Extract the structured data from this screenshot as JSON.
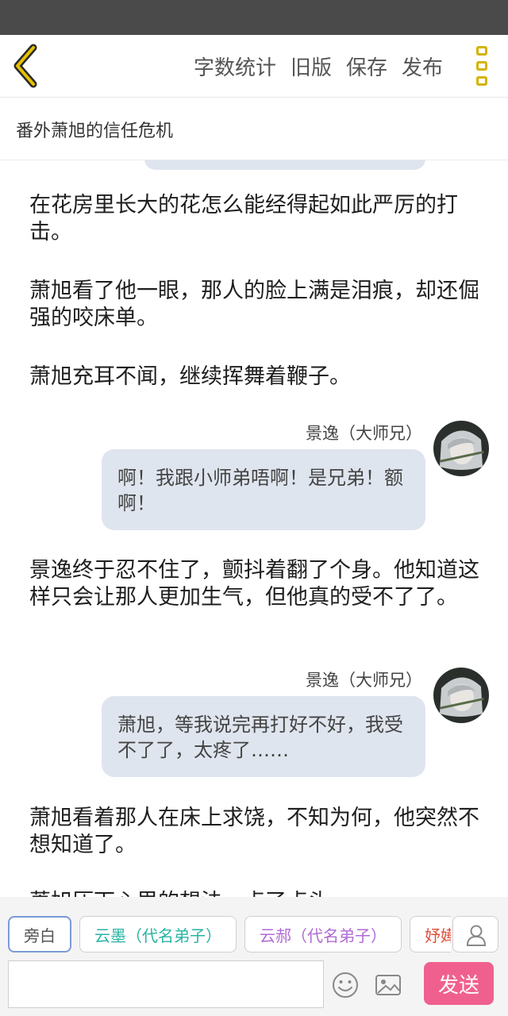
{
  "header": {
    "actions": [
      "字数统计",
      "旧版",
      "保存",
      "发布"
    ],
    "title": "番外萧旭的信任危机"
  },
  "story": {
    "paragraphs": [
      "在花房里长大的花怎么能经得起如此严厉的打击。",
      "萧旭看了他一眼，那人的脸上满是泪痕，却还倔强的咬床单。",
      "萧旭充耳不闻，继续挥舞着鞭子。",
      "景逸终于忍不住了，颤抖着翻了个身。他知道这样只会让那人更加生气，但他真的受不了了。",
      "萧旭看着那人在床上求饶，不知为何，他突然不想知道了。",
      "萧旭压下心里的想法，点了点头。"
    ],
    "dialogues": [
      {
        "speaker": "景逸（大师兄）",
        "text": "啊！我跟小师弟唔啊！是兄弟！额啊！"
      },
      {
        "speaker": "景逸（大师兄）",
        "text": "萧旭，等我说完再打好不好，我受不了了，太疼了……"
      }
    ]
  },
  "roles": [
    "旁白",
    "云墨（代名弟子）",
    "云郝（代名弟子）",
    "妤嬅"
  ],
  "composer": {
    "input_value": "",
    "send_label": "发送"
  },
  "icons": {
    "back": "chevron-left-icon",
    "menu": "more-vertical-icon",
    "user": "user-icon",
    "emoji": "smiley-icon",
    "image": "image-icon"
  },
  "colors": {
    "accent_yellow": "#d4b300",
    "bubble_bg": "#dfe5ee",
    "send_pink": "#f0608f",
    "role_narration": "#555555",
    "role_yunmo": "#27b3a3",
    "role_yunhao": "#b06ad4",
    "role_yuhua": "#e0503c"
  }
}
